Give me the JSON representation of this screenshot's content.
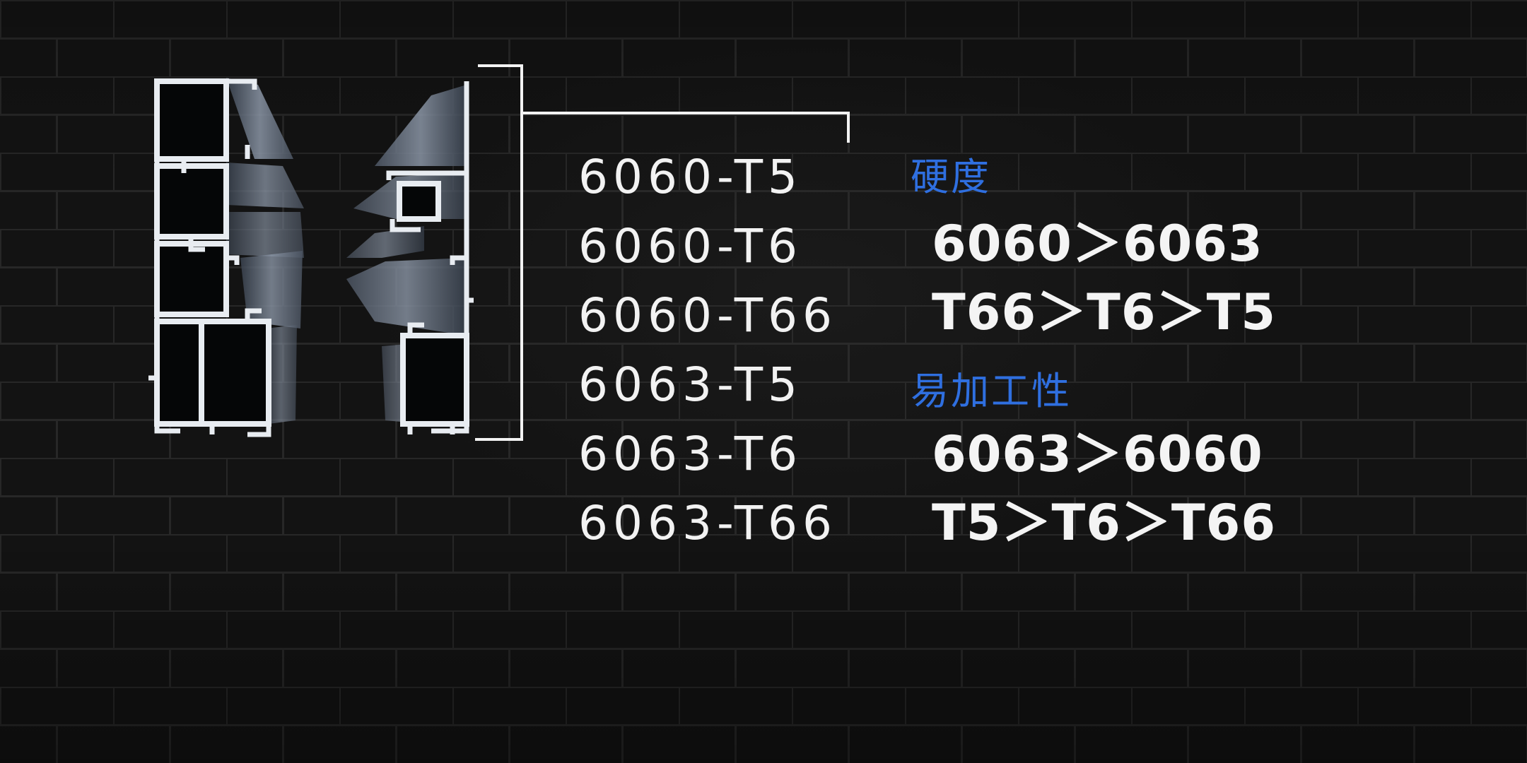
{
  "grades": [
    "6060-T5",
    "6060-T6",
    "6060-T66",
    "6063-T5",
    "6063-T6",
    "6063-T66"
  ],
  "hardness": {
    "label": "硬度",
    "comparisons": [
      "6060＞6063",
      "T66＞T6＞T5"
    ]
  },
  "machinability": {
    "label": "易加工性",
    "comparisons": [
      "6063＞6060",
      "T5＞T6＞T66"
    ]
  },
  "colors": {
    "label_blue": "#2f6fe0",
    "text_white": "#f2f2f2",
    "background": "#101010"
  }
}
